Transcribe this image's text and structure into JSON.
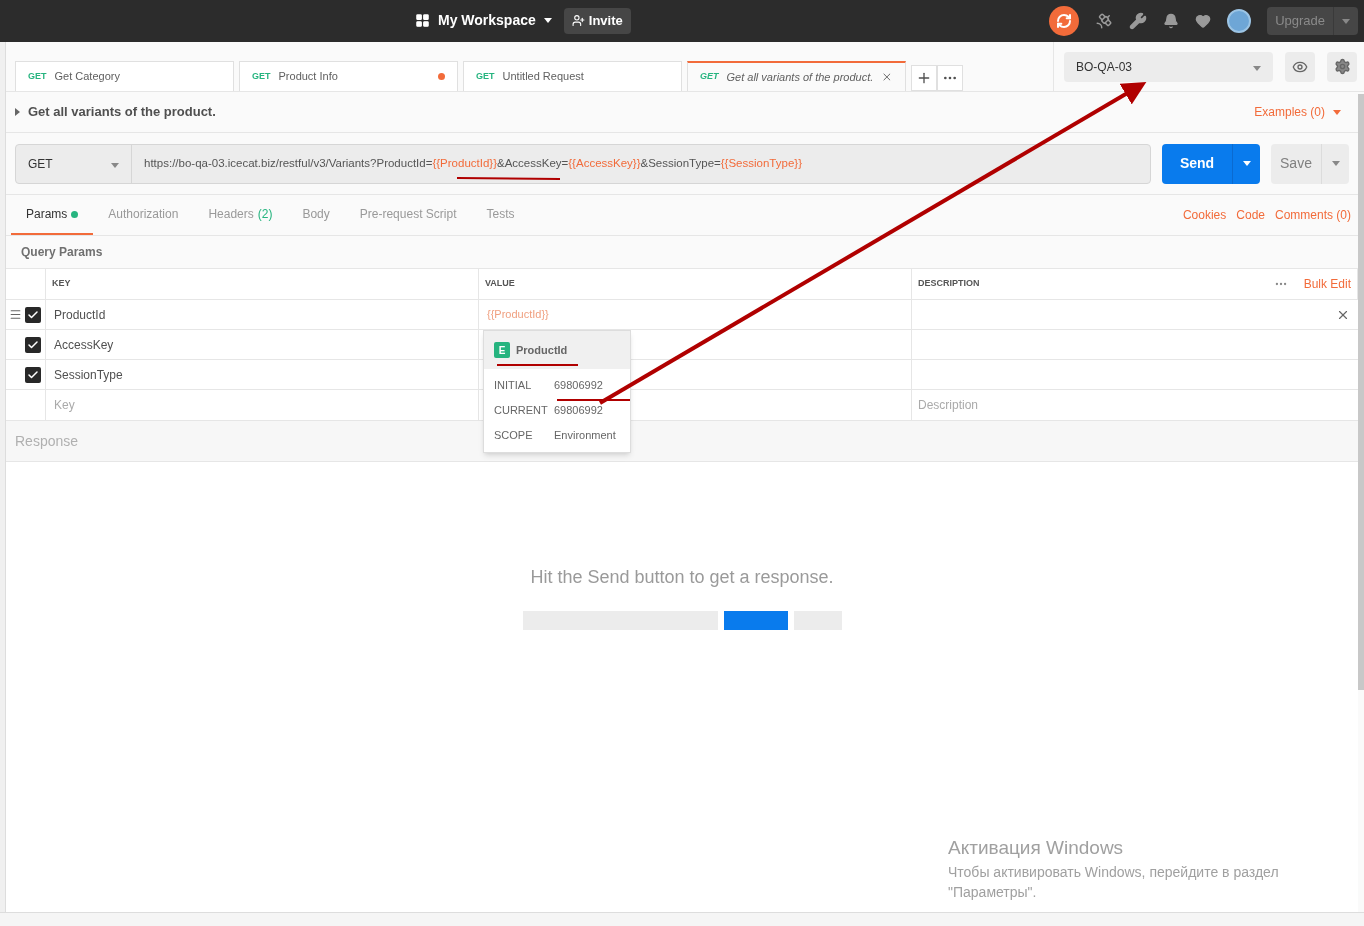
{
  "header": {
    "workspace": "My Workspace",
    "invite": "Invite",
    "upgrade": "Upgrade"
  },
  "request_tabs": [
    {
      "method": "GET",
      "name": "Get Category",
      "selected": false,
      "unsaved": false,
      "preview": false
    },
    {
      "method": "GET",
      "name": "Product Info",
      "selected": false,
      "unsaved": true,
      "preview": false
    },
    {
      "method": "GET",
      "name": "Untitled Request",
      "selected": false,
      "unsaved": false,
      "preview": false
    },
    {
      "method": "GET",
      "name": "Get all variants of the product.",
      "selected": true,
      "unsaved": false,
      "preview": true
    }
  ],
  "environment": {
    "name": "BO-QA-03"
  },
  "request": {
    "title": "Get all variants of the product.",
    "examples": "Examples (0)",
    "method": "GET",
    "url": [
      {
        "text": "https://bo-qa-03.icecat.biz/restful/v3/Variants?ProductId=",
        "kind": "plain"
      },
      {
        "text": "{{ProductId}}",
        "kind": "variable"
      },
      {
        "text": "&AccessKey=",
        "kind": "plain"
      },
      {
        "text": "{{AccessKey}}",
        "kind": "variable"
      },
      {
        "text": "&SessionType=",
        "kind": "plain"
      },
      {
        "text": "{{SessionType}}",
        "kind": "variable"
      }
    ],
    "send": "Send",
    "save": "Save"
  },
  "sub_tabs": [
    {
      "label": "Params",
      "selected": true,
      "dot": true
    },
    {
      "label": "Authorization",
      "selected": false,
      "dot": false
    },
    {
      "label": "Headers",
      "count": "(2)",
      "selected": false,
      "dot": false
    },
    {
      "label": "Body",
      "selected": false,
      "dot": false
    },
    {
      "label": "Pre-request Script",
      "selected": false,
      "dot": false
    },
    {
      "label": "Tests",
      "selected": false,
      "dot": false
    }
  ],
  "links": [
    "Cookies",
    "Code",
    "Comments (0)"
  ],
  "params": {
    "title": "Query Params",
    "columns": [
      "KEY",
      "VALUE",
      "DESCRIPTION"
    ],
    "bulk_edit": "Bulk Edit",
    "rows": [
      {
        "key": "ProductId",
        "value": "{{ProductId}}",
        "checked": true
      },
      {
        "key": "AccessKey",
        "checked": true
      },
      {
        "key": "SessionType",
        "checked": true
      }
    ],
    "key_placeholder": "Key",
    "description_placeholder": "Description"
  },
  "variable_popup": {
    "badge": "E",
    "name": "ProductId",
    "fields": [
      {
        "label": "INITIAL",
        "value": "69806992"
      },
      {
        "label": "CURRENT",
        "value": "69806992"
      },
      {
        "label": "SCOPE",
        "value": "Environment"
      }
    ]
  },
  "response": {
    "title": "Response",
    "hint": "Hit the Send button to get a response."
  },
  "activation": {
    "title": "Активация Windows",
    "text": "Чтобы активировать Windows, перейдите в раздел \"Параметры\"."
  }
}
